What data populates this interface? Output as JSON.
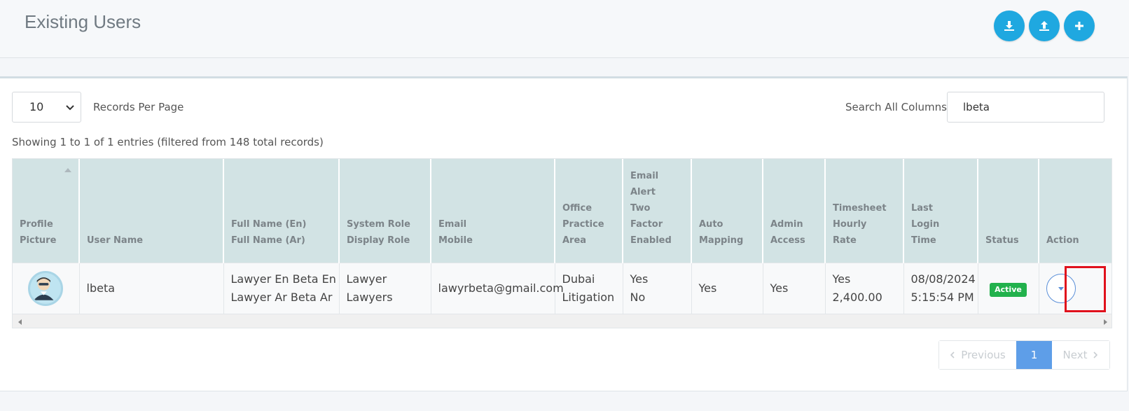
{
  "header": {
    "title": "Existing Users",
    "buttons": [
      {
        "name": "download",
        "icon": "download-icon"
      },
      {
        "name": "upload",
        "icon": "upload-icon"
      },
      {
        "name": "add",
        "icon": "plus-icon"
      }
    ]
  },
  "controls": {
    "page_size": "10",
    "records_per_page_label": "Records Per Page",
    "search_label": "Search All Columns",
    "search_value": "lbeta",
    "info": "Showing 1 to 1 of 1 entries (filtered from 148 total records)"
  },
  "table": {
    "columns": [
      [
        "Profile",
        "Picture"
      ],
      [
        "User Name"
      ],
      [
        "Full Name (En)",
        "Full Name (Ar)"
      ],
      [
        "System Role",
        "Display Role"
      ],
      [
        "Email",
        "Mobile"
      ],
      [
        "Office",
        "Practice",
        "Area"
      ],
      [
        "Email",
        "Alert",
        "Two",
        "Factor",
        "Enabled"
      ],
      [
        "Auto",
        "Mapping"
      ],
      [
        "Admin",
        "Access"
      ],
      [
        "Timesheet",
        "Hourly",
        "Rate"
      ],
      [
        "Last",
        "Login",
        "Time"
      ],
      [
        "Status"
      ],
      [
        "Action"
      ]
    ],
    "rows": [
      {
        "avatar": "user-avatar",
        "user_name": "lbeta",
        "full_name_en": "Lawyer En Beta En",
        "full_name_ar": "Lawyer Ar Beta Ar",
        "system_role": "Lawyer",
        "display_role": "Lawyers",
        "email": "lawyrbeta@gmail.com",
        "mobile": "",
        "office": "Dubai",
        "practice_area": "Litigation",
        "email_alert": "Yes",
        "two_factor": "No",
        "auto_mapping": "Yes",
        "admin_access": "Yes",
        "timesheet": "Yes",
        "hourly_rate": "2,400.00",
        "last_login_date": "08/08/2024",
        "last_login_time": "5:15:54 PM",
        "status": "Active"
      }
    ]
  },
  "pagination": {
    "previous": "Previous",
    "current": "1",
    "next": "Next"
  },
  "colors": {
    "accent": "#1fa8e0",
    "header_bg": "#d2e3e4",
    "status_active": "#22b14c",
    "page_current": "#5e9ee8",
    "highlight": "#e0111c"
  }
}
